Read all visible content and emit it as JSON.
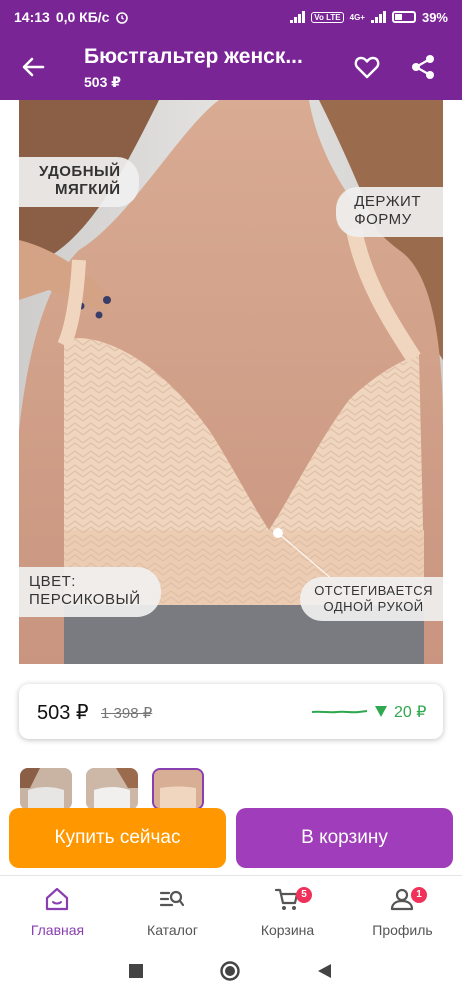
{
  "status_bar": {
    "time": "14:13",
    "speed": "0,0 КБ/с",
    "battery": "39%",
    "network_label": "4G+",
    "volte_label": "Vo LTE"
  },
  "header": {
    "title": "Бюстгальтер женск...",
    "price": "503 ₽",
    "icons": [
      "back-arrow-icon",
      "heart-icon",
      "share-icon"
    ]
  },
  "product_image": {
    "tags": {
      "comfort": "УДОБНЫЙ\nМЯГКИЙ",
      "shape": "ДЕРЖИТ\nФОРМУ",
      "color": "ЦВЕТ:\nПЕРСИКОВЫЙ",
      "one_hand": "ОТСТЕГИВАЕТСЯ\nОДНОЙ РУКОЙ"
    }
  },
  "price_card": {
    "current": "503 ₽",
    "old": "1 398 ₽",
    "drop": "20 ₽"
  },
  "actions": {
    "buy_now": "Купить сейчас",
    "add_to_cart": "В корзину"
  },
  "bottom_nav": {
    "items": [
      {
        "label": "Главная",
        "icon": "home-icon",
        "active": true
      },
      {
        "label": "Каталог",
        "icon": "catalog-search-icon"
      },
      {
        "label": "Корзина",
        "icon": "cart-icon",
        "badge": "5"
      },
      {
        "label": "Профиль",
        "icon": "profile-icon",
        "badge": "1"
      }
    ]
  },
  "colors": {
    "brand": "#7a2596",
    "buy_now": "#ff9800",
    "add_to_cart": "#a03dba",
    "price_drop": "#2fa84f",
    "badge": "#f0325a"
  }
}
